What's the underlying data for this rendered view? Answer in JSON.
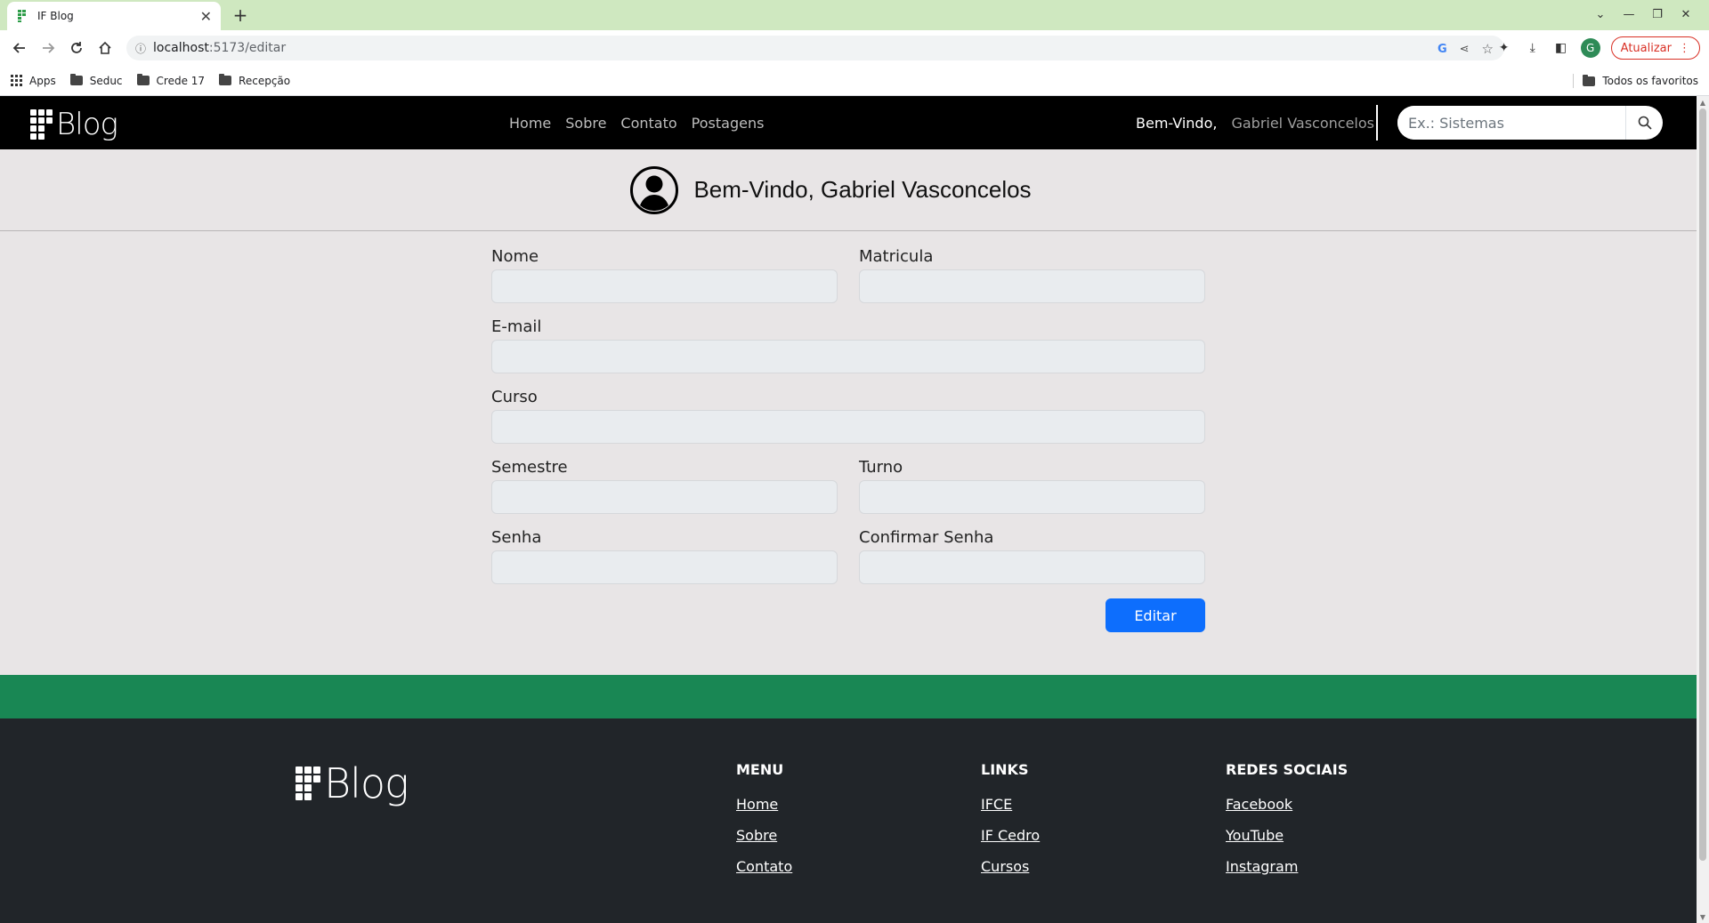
{
  "browser": {
    "tab_title": "IF Blog",
    "url_host": "localhost",
    "url_path": ":5173/editar",
    "update_label": "Atualizar",
    "profile_initial": "G",
    "bookmarks": [
      "Apps",
      "Seduc",
      "Crede 17",
      "Recepção"
    ],
    "all_bookmarks": "Todos os favoritos"
  },
  "site": {
    "logo_text": "Blog",
    "nav": [
      "Home",
      "Sobre",
      "Contato",
      "Postagens"
    ],
    "greeting": "Bem-Vindo,",
    "user_name": "Gabriel Vasconcelos",
    "search_placeholder": "Ex.: Sistemas"
  },
  "welcome": {
    "title": "Bem-Vindo, Gabriel Vasconcelos"
  },
  "form": {
    "nome_label": "Nome",
    "matricula_label": "Matricula",
    "email_label": "E-mail",
    "curso_label": "Curso",
    "semestre_label": "Semestre",
    "turno_label": "Turno",
    "senha_label": "Senha",
    "confirmar_senha_label": "Confirmar Senha",
    "submit_label": "Editar"
  },
  "footer": {
    "logo_text": "Blog",
    "menu": {
      "title": "MENU",
      "links": [
        "Home",
        "Sobre",
        "Contato"
      ]
    },
    "links": {
      "title": "LINKS",
      "links": [
        "IFCE",
        "IF Cedro",
        "Cursos"
      ]
    },
    "social": {
      "title": "REDES SOCIAIS",
      "links": [
        "Facebook",
        "YouTube",
        "Instagram"
      ]
    }
  },
  "colors": {
    "nav_bg": "#000000",
    "page_bg": "#e8e5e6",
    "primary": "#0d6efd",
    "green_band": "#198754",
    "footer_bg": "#212529"
  }
}
